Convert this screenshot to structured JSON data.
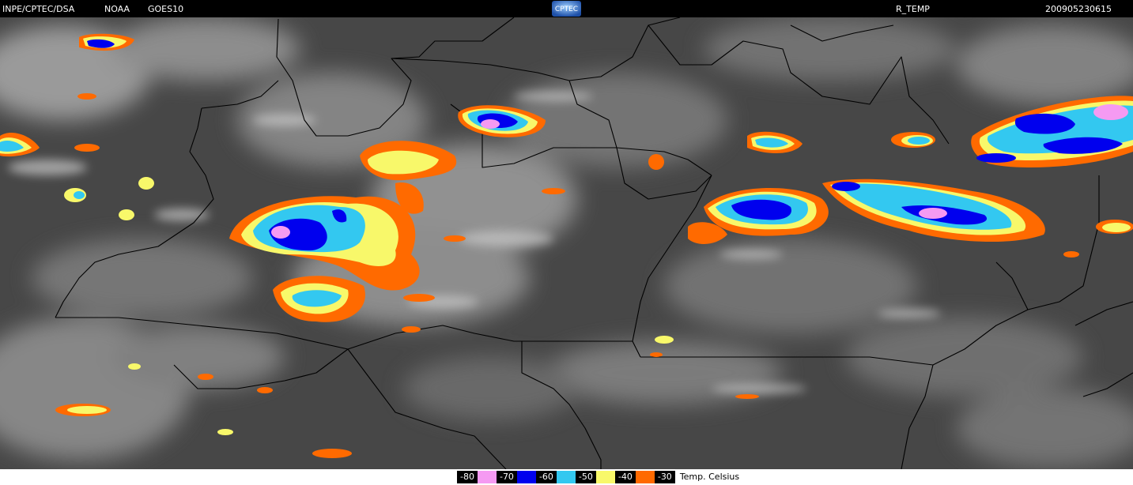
{
  "header": {
    "org": "INPE/CPTEC/DSA",
    "agency": "NOAA",
    "satellite": "GOES10",
    "product": "R_TEMP",
    "timestamp": "200905230615",
    "logo_text": "CPTEC"
  },
  "legend": {
    "items": [
      {
        "label": "-80",
        "color": "#f59af2"
      },
      {
        "label": "-70",
        "color": "#0000ee"
      },
      {
        "label": "-60",
        "color": "#33c8f0"
      },
      {
        "label": "-50",
        "color": "#f8f86a"
      },
      {
        "label": "-40",
        "color": "#ff6a00"
      },
      {
        "label": "-30",
        "color": ""
      }
    ],
    "unit": "Temp. Celsius"
  },
  "colors": {
    "background": "#4a4a4a",
    "border": "#000000",
    "cloud": "#bdbdbd"
  }
}
